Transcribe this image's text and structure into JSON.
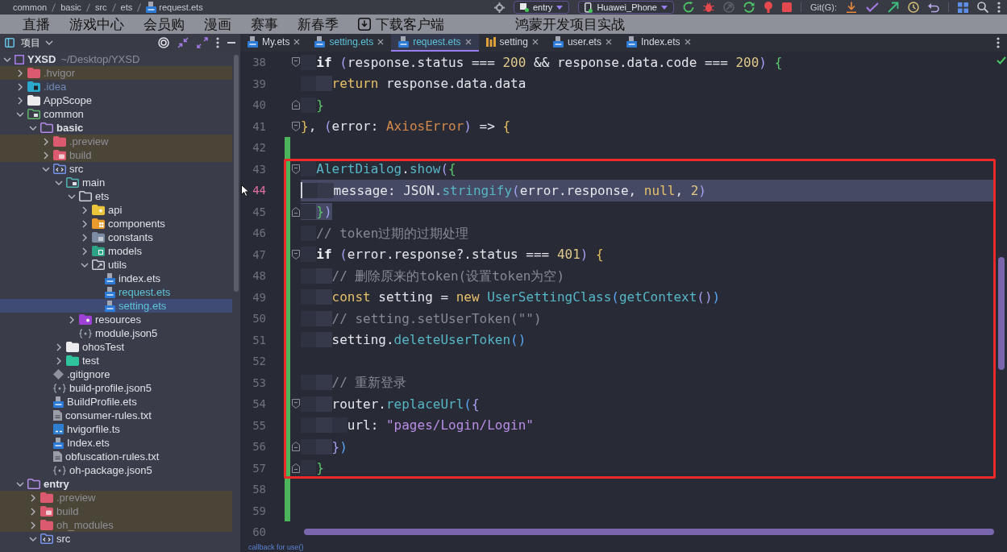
{
  "toolbar": {
    "breadcrumb": [
      "common",
      "basic",
      "src",
      "ets",
      "request.ets"
    ],
    "run_config": "entry",
    "device": "Huawei_Phone",
    "vcs_label": "Git(G):"
  },
  "site_nav": {
    "items": [
      {
        "label": "直播",
        "kind": "link"
      },
      {
        "label": "游戏中心",
        "kind": "link"
      },
      {
        "label": "会员购",
        "kind": "link"
      },
      {
        "label": "漫画",
        "kind": "link"
      },
      {
        "label": "赛事",
        "kind": "link"
      },
      {
        "label": "新春季",
        "kind": "link"
      },
      {
        "label": "下载客户端",
        "kind": "download"
      }
    ],
    "video_title": "鸿蒙开发项目实战"
  },
  "project_panel": {
    "title": "项目",
    "tree": [
      {
        "label": "YXSD",
        "path": "~/Desktop/YXSD",
        "kind": "project",
        "expanded": true,
        "selected": false,
        "excluded": false,
        "ignored": false,
        "modified": false,
        "children": [
          {
            "label": ".hvigor",
            "kind": "excluded-folder",
            "expanded": false,
            "selected": false,
            "excluded": true,
            "ignored": false,
            "modified": false
          },
          {
            "label": ".idea",
            "kind": "idea-folder",
            "expanded": false,
            "selected": false,
            "excluded": false,
            "ignored": true,
            "modified": false
          },
          {
            "label": "AppScope",
            "kind": "folder",
            "expanded": false,
            "selected": false,
            "excluded": false,
            "ignored": false,
            "modified": false
          },
          {
            "label": "common",
            "kind": "module-group",
            "expanded": true,
            "selected": false,
            "excluded": false,
            "ignored": false,
            "modified": false,
            "children": [
              {
                "label": "basic",
                "kind": "module",
                "expanded": true,
                "selected": false,
                "excluded": false,
                "ignored": false,
                "modified": false,
                "children": [
                  {
                    "label": ".preview",
                    "kind": "excluded-folder",
                    "expanded": false,
                    "selected": false,
                    "excluded": true,
                    "ignored": false,
                    "modified": false
                  },
                  {
                    "label": "build",
                    "kind": "build-folder",
                    "expanded": false,
                    "selected": false,
                    "excluded": true,
                    "ignored": false,
                    "modified": false
                  },
                  {
                    "label": "src",
                    "kind": "source-folder",
                    "expanded": true,
                    "selected": false,
                    "excluded": false,
                    "ignored": false,
                    "modified": false,
                    "children": [
                      {
                        "label": "main",
                        "kind": "main-folder",
                        "expanded": true,
                        "selected": false,
                        "excluded": false,
                        "ignored": false,
                        "modified": false,
                        "children": [
                          {
                            "label": "ets",
                            "kind": "plain-folder",
                            "expanded": true,
                            "selected": false,
                            "excluded": false,
                            "ignored": false,
                            "modified": false,
                            "children": [
                              {
                                "label": "api",
                                "kind": "api-folder",
                                "expanded": false,
                                "selected": false,
                                "excluded": false,
                                "ignored": false,
                                "modified": false
                              },
                              {
                                "label": "components",
                                "kind": "components-folder",
                                "expanded": false,
                                "selected": false,
                                "excluded": false,
                                "ignored": false,
                                "modified": false
                              },
                              {
                                "label": "constants",
                                "kind": "constants-folder",
                                "expanded": false,
                                "selected": false,
                                "excluded": false,
                                "ignored": false,
                                "modified": false
                              },
                              {
                                "label": "models",
                                "kind": "models-folder",
                                "expanded": false,
                                "selected": false,
                                "excluded": false,
                                "ignored": false,
                                "modified": false
                              },
                              {
                                "label": "utils",
                                "kind": "utils-folder",
                                "expanded": true,
                                "selected": false,
                                "excluded": false,
                                "ignored": false,
                                "modified": false,
                                "children": [
                                  {
                                    "label": "index.ets",
                                    "kind": "ets-file",
                                    "selected": false,
                                    "excluded": false,
                                    "ignored": false,
                                    "modified": false
                                  },
                                  {
                                    "label": "request.ets",
                                    "kind": "ets-file",
                                    "selected": false,
                                    "excluded": false,
                                    "ignored": false,
                                    "modified": true
                                  },
                                  {
                                    "label": "setting.ets",
                                    "kind": "ets-file",
                                    "selected": true,
                                    "excluded": false,
                                    "ignored": false,
                                    "modified": true
                                  }
                                ]
                              }
                            ]
                          },
                          {
                            "label": "resources",
                            "kind": "resources-folder",
                            "expanded": false,
                            "selected": false,
                            "excluded": false,
                            "ignored": false,
                            "modified": false
                          },
                          {
                            "label": "module.json5",
                            "kind": "json5-file",
                            "selected": false,
                            "excluded": false,
                            "ignored": false,
                            "modified": false
                          }
                        ]
                      },
                      {
                        "label": "ohosTest",
                        "kind": "folder",
                        "expanded": false,
                        "selected": false,
                        "excluded": false,
                        "ignored": false,
                        "modified": false
                      },
                      {
                        "label": "test",
                        "kind": "test-folder",
                        "expanded": false,
                        "selected": false,
                        "excluded": false,
                        "ignored": false,
                        "modified": false
                      }
                    ]
                  },
                  {
                    "label": ".gitignore",
                    "kind": "git-file",
                    "selected": false,
                    "excluded": false,
                    "ignored": false,
                    "modified": false
                  },
                  {
                    "label": "build-profile.json5",
                    "kind": "json5-file",
                    "selected": false,
                    "excluded": false,
                    "ignored": false,
                    "modified": false
                  },
                  {
                    "label": "BuildProfile.ets",
                    "kind": "ets-file",
                    "selected": false,
                    "excluded": false,
                    "ignored": false,
                    "modified": false
                  },
                  {
                    "label": "consumer-rules.txt",
                    "kind": "text-file",
                    "selected": false,
                    "excluded": false,
                    "ignored": false,
                    "modified": false
                  },
                  {
                    "label": "hvigorfile.ts",
                    "kind": "ts-file",
                    "selected": false,
                    "excluded": false,
                    "ignored": false,
                    "modified": false
                  },
                  {
                    "label": "Index.ets",
                    "kind": "ets-file",
                    "selected": false,
                    "excluded": false,
                    "ignored": false,
                    "modified": false
                  },
                  {
                    "label": "obfuscation-rules.txt",
                    "kind": "text-file",
                    "selected": false,
                    "excluded": false,
                    "ignored": false,
                    "modified": false
                  },
                  {
                    "label": "oh-package.json5",
                    "kind": "json5-file",
                    "selected": false,
                    "excluded": false,
                    "ignored": false,
                    "modified": false
                  }
                ]
              }
            ]
          },
          {
            "label": "entry",
            "kind": "module",
            "expanded": true,
            "selected": false,
            "excluded": false,
            "ignored": false,
            "modified": false,
            "children": [
              {
                "label": ".preview",
                "kind": "excluded-folder",
                "expanded": false,
                "selected": false,
                "excluded": true,
                "ignored": false,
                "modified": false
              },
              {
                "label": "build",
                "kind": "build-folder",
                "expanded": false,
                "selected": false,
                "excluded": true,
                "ignored": false,
                "modified": false
              },
              {
                "label": "oh_modules",
                "kind": "excluded-folder",
                "expanded": false,
                "selected": false,
                "excluded": true,
                "ignored": false,
                "modified": false
              },
              {
                "label": "src",
                "kind": "source-folder",
                "expanded": true,
                "selected": false,
                "excluded": false,
                "ignored": false,
                "modified": false
              }
            ]
          }
        ]
      }
    ]
  },
  "tabs": [
    {
      "label": "My.ets",
      "kind": "ets",
      "selected": false,
      "modified": false
    },
    {
      "label": "setting.ets",
      "kind": "ets",
      "selected": false,
      "modified": true
    },
    {
      "label": "request.ets",
      "kind": "ets",
      "selected": true,
      "modified": true
    },
    {
      "label": "setting",
      "kind": "props",
      "selected": false,
      "modified": false
    },
    {
      "label": "user.ets",
      "kind": "ets",
      "selected": false,
      "modified": false
    },
    {
      "label": "Index.ets",
      "kind": "ets",
      "selected": false,
      "modified": false
    }
  ],
  "editor": {
    "sections": [
      {
        "annotated": false,
        "lines": [
          {
            "number": "38",
            "kind": "opener",
            "selected": false,
            "current": false,
            "changed": false,
            "tokens": [
              {
                "kind": "ctl",
                "text": "  if"
              },
              {
                "kind": "p1",
                "text": " ("
              },
              {
                "kind": "plain",
                "text": "response.status === "
              },
              {
                "kind": "num",
                "text": "200"
              },
              {
                "kind": "plain",
                "text": " && response.data.code === "
              },
              {
                "kind": "num",
                "text": "200"
              },
              {
                "kind": "p1",
                "text": ")"
              },
              {
                "kind": "p2",
                "text": " {"
              }
            ]
          },
          {
            "number": "39",
            "kind": "plain",
            "selected": false,
            "current": false,
            "changed": false,
            "tokens": [
              {
                "kind": "kw",
                "text": "    return"
              },
              {
                "kind": "plain",
                "text": " response.data.data"
              }
            ]
          },
          {
            "number": "40",
            "kind": "closer",
            "selected": false,
            "current": false,
            "changed": false,
            "tokens": [
              {
                "kind": "p2",
                "text": "  }"
              }
            ]
          },
          {
            "number": "41",
            "kind": "opener",
            "selected": false,
            "current": false,
            "changed": false,
            "tokens": [
              {
                "kind": "p3",
                "text": "}"
              },
              {
                "kind": "plain",
                "text": ", "
              },
              {
                "kind": "p1",
                "text": "("
              },
              {
                "kind": "plain",
                "text": "error: "
              },
              {
                "kind": "type",
                "text": "AxiosError"
              },
              {
                "kind": "p1",
                "text": ")"
              },
              {
                "kind": "plain",
                "text": " => "
              },
              {
                "kind": "p3",
                "text": "{"
              }
            ]
          },
          {
            "number": "42",
            "kind": "plain",
            "selected": false,
            "current": false,
            "changed": true
          }
        ]
      },
      {
        "annotated": true,
        "lines": [
          {
            "number": "43",
            "kind": "opener",
            "selected": false,
            "current": false,
            "changed": true,
            "tokens": [
              {
                "kind": "fn",
                "text": "  AlertDialog"
              },
              {
                "kind": "plain",
                "text": "."
              },
              {
                "kind": "fn",
                "text": "show"
              },
              {
                "kind": "p1",
                "text": "("
              },
              {
                "kind": "p2",
                "text": "{"
              }
            ]
          },
          {
            "number": "44",
            "kind": "plain",
            "selected": true,
            "current": true,
            "changed": true,
            "tokens": [
              {
                "kind": "plain",
                "text": "    message: JSON."
              },
              {
                "kind": "fn",
                "text": "stringify"
              },
              {
                "kind": "p1",
                "text": "("
              },
              {
                "kind": "plain",
                "text": "error.response, "
              },
              {
                "kind": "kw",
                "text": "null"
              },
              {
                "kind": "plain",
                "text": ", "
              },
              {
                "kind": "num",
                "text": "2"
              },
              {
                "kind": "p1",
                "text": ")"
              }
            ]
          },
          {
            "number": "45",
            "kind": "closer",
            "selected": true,
            "current": false,
            "changed": true,
            "tokens": [
              {
                "kind": "p2",
                "text": "  }"
              },
              {
                "kind": "p1",
                "text": ")"
              }
            ]
          },
          {
            "number": "46",
            "kind": "plain",
            "selected": false,
            "current": false,
            "changed": true,
            "tokens": [
              {
                "kind": "com",
                "text": "  // token过期的过期处理"
              }
            ]
          },
          {
            "number": "47",
            "kind": "opener",
            "selected": false,
            "current": false,
            "changed": true,
            "tokens": [
              {
                "kind": "ctl",
                "text": "  if"
              },
              {
                "kind": "p1",
                "text": " ("
              },
              {
                "kind": "plain",
                "text": "error.response?.status === "
              },
              {
                "kind": "num",
                "text": "401"
              },
              {
                "kind": "p1",
                "text": ")"
              },
              {
                "kind": "p3",
                "text": " {"
              }
            ]
          },
          {
            "number": "48",
            "kind": "plain",
            "selected": false,
            "current": false,
            "changed": true,
            "tokens": [
              {
                "kind": "com",
                "text": "    // 删除原来的token(设置token为空)"
              }
            ]
          },
          {
            "number": "49",
            "kind": "plain",
            "selected": false,
            "current": false,
            "changed": true,
            "tokens": [
              {
                "kind": "kw",
                "text": "    const"
              },
              {
                "kind": "plain",
                "text": " setting = "
              },
              {
                "kind": "kw",
                "text": "new"
              },
              {
                "kind": "fn",
                "text": " UserSettingClass"
              },
              {
                "kind": "p4",
                "text": "("
              },
              {
                "kind": "fn",
                "text": "getContext"
              },
              {
                "kind": "p1",
                "text": "()"
              },
              {
                "kind": "p4",
                "text": ")"
              }
            ]
          },
          {
            "number": "50",
            "kind": "plain",
            "selected": false,
            "current": false,
            "changed": true,
            "tokens": [
              {
                "kind": "com",
                "text": "    // setting.setUserToken(\"\")"
              }
            ]
          },
          {
            "number": "51",
            "kind": "plain",
            "selected": false,
            "current": false,
            "changed": true,
            "tokens": [
              {
                "kind": "plain",
                "text": "    setting."
              },
              {
                "kind": "fn",
                "text": "deleteUserToken"
              },
              {
                "kind": "p4",
                "text": "()"
              }
            ]
          },
          {
            "number": "52",
            "kind": "plain",
            "selected": false,
            "current": false,
            "changed": true
          },
          {
            "number": "53",
            "kind": "plain",
            "selected": false,
            "current": false,
            "changed": true,
            "tokens": [
              {
                "kind": "com",
                "text": "    // 重新登录"
              }
            ]
          },
          {
            "number": "54",
            "kind": "opener",
            "selected": false,
            "current": false,
            "changed": true,
            "tokens": [
              {
                "kind": "plain",
                "text": "    router."
              },
              {
                "kind": "fn",
                "text": "replaceUrl"
              },
              {
                "kind": "p4",
                "text": "("
              },
              {
                "kind": "p1",
                "text": "{"
              }
            ]
          },
          {
            "number": "55",
            "kind": "plain",
            "selected": false,
            "current": false,
            "changed": true,
            "tokens": [
              {
                "kind": "plain",
                "text": "      url: "
              },
              {
                "kind": "str",
                "text": "\"pages/Login/Login\""
              }
            ]
          },
          {
            "number": "56",
            "kind": "closer",
            "selected": false,
            "current": false,
            "changed": true,
            "tokens": [
              {
                "kind": "p1",
                "text": "    }"
              },
              {
                "kind": "p4",
                "text": ")"
              }
            ]
          },
          {
            "number": "57",
            "kind": "closer",
            "selected": false,
            "current": false,
            "changed": true,
            "tokens": [
              {
                "kind": "p2",
                "text": "  }"
              }
            ]
          }
        ]
      },
      {
        "annotated": false,
        "lines": [
          {
            "number": "58",
            "kind": "plain",
            "selected": false,
            "current": false,
            "changed": true
          },
          {
            "number": "59",
            "kind": "plain",
            "selected": false,
            "current": false,
            "changed": true
          },
          {
            "number": "60",
            "kind": "plain",
            "selected": false,
            "current": false,
            "changed": false
          }
        ]
      }
    ],
    "hint": "callback for use()"
  }
}
